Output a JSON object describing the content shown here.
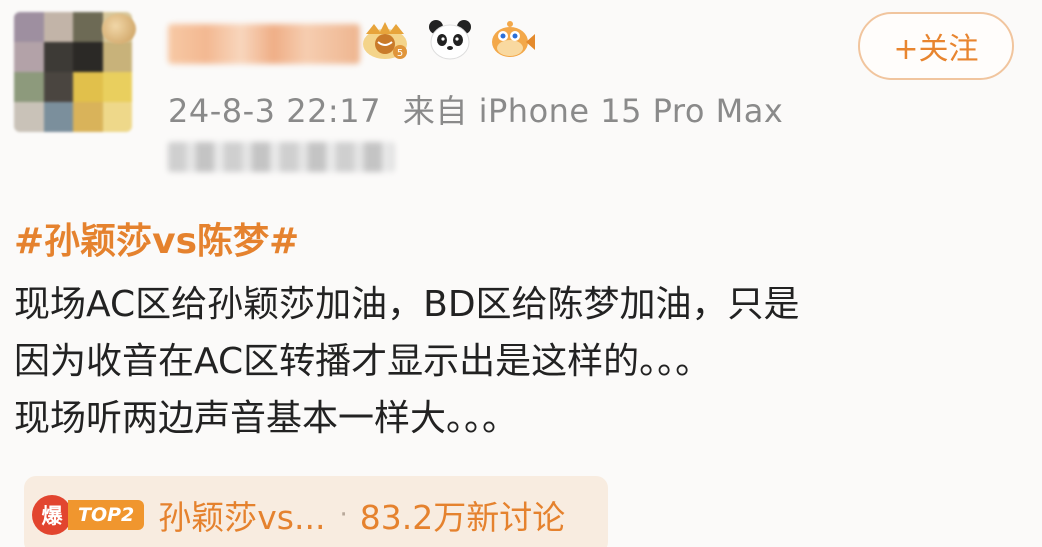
{
  "post": {
    "follow_label": "+关注",
    "time": "24-8-3 22:17",
    "source": "来自 iPhone 15 Pro Max",
    "hashtag": "#孙颖莎vs陈梦#",
    "body_lines": [
      "现场AC区给孙颖莎加油，BD区给陈梦加油，只是",
      "因为收音在AC区转播才显示出是这样的。。。",
      "现场听两边声音基本一样大。。。"
    ]
  },
  "badges": [
    "crown-badge-icon",
    "panda-icon",
    "pufferfish-icon"
  ],
  "topic": {
    "hot_label": "爆",
    "rank": "TOP2",
    "name": "孙颖莎vs...",
    "separator": "·",
    "count": "83.2万新讨论"
  },
  "colors": {
    "accent": "#e5822e",
    "hot_red": "#e2452f",
    "rank_orange": "#f0962e",
    "meta_gray": "#8a8a8a",
    "text": "#222222",
    "topic_bg": "#f8ece0"
  }
}
